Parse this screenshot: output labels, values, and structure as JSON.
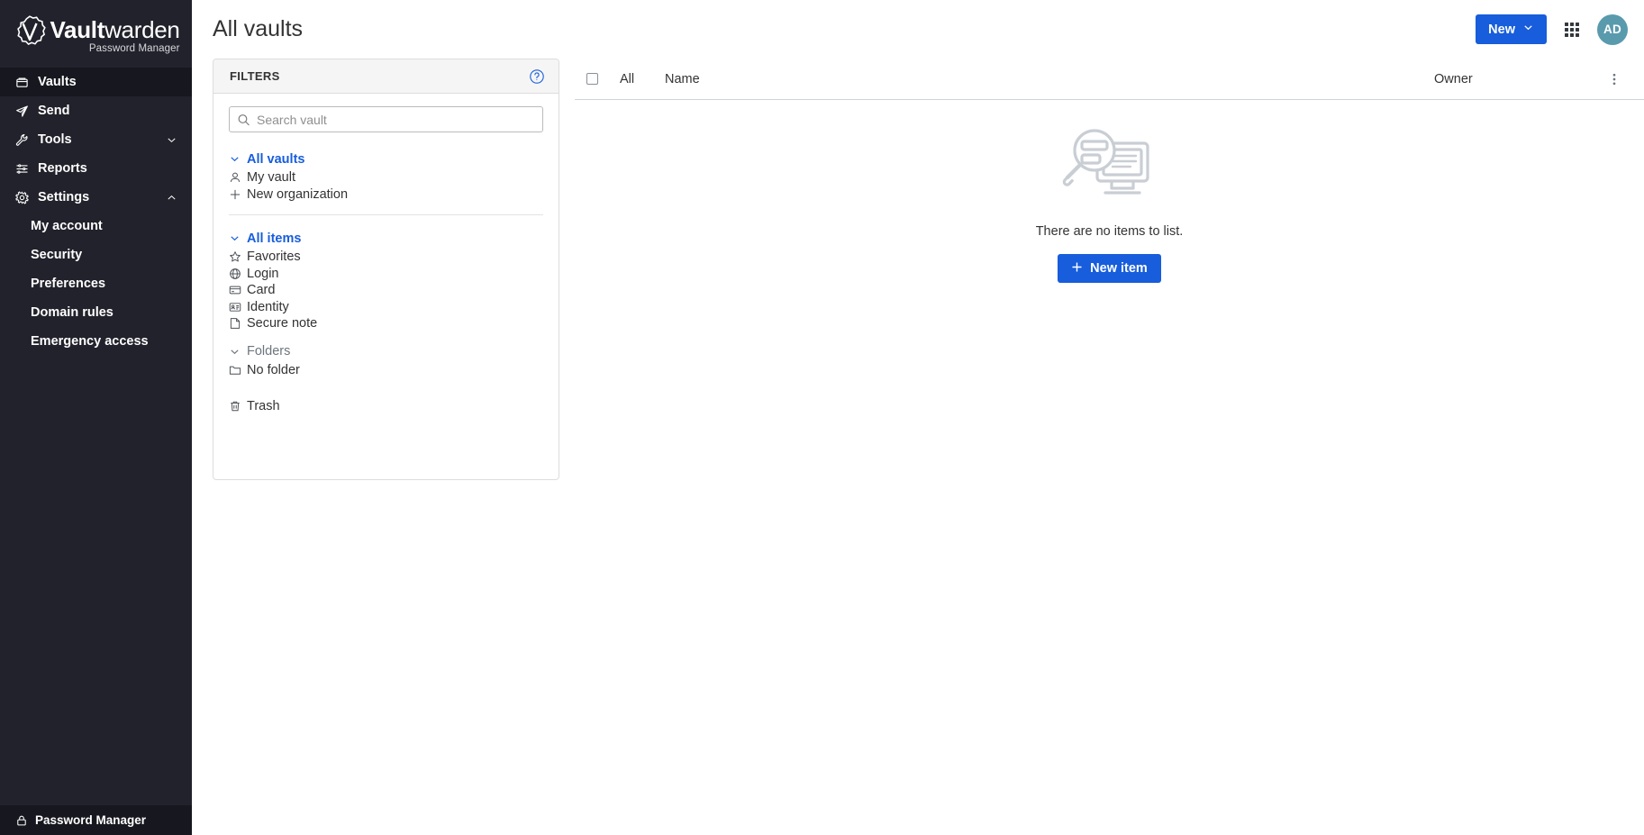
{
  "brand": {
    "name_bold": "ault",
    "name_light": "warden",
    "name_initial": "V",
    "subtitle": "Password Manager",
    "accent": "#175ddc",
    "sidebar_bg": "#21222b"
  },
  "sidebar": {
    "items": [
      {
        "label": "Vaults",
        "icon": "vault-icon",
        "active": true,
        "expandable": false
      },
      {
        "label": "Send",
        "icon": "send-icon",
        "active": false,
        "expandable": false
      },
      {
        "label": "Tools",
        "icon": "wrench-icon",
        "active": false,
        "expandable": true,
        "expanded": false
      },
      {
        "label": "Reports",
        "icon": "reports-icon",
        "active": false,
        "expandable": false
      },
      {
        "label": "Settings",
        "icon": "gear-icon",
        "active": false,
        "expandable": true,
        "expanded": true
      }
    ],
    "settings_children": [
      {
        "label": "My account"
      },
      {
        "label": "Security"
      },
      {
        "label": "Preferences"
      },
      {
        "label": "Domain rules"
      },
      {
        "label": "Emergency access"
      }
    ],
    "footer": {
      "label": "Password Manager",
      "icon": "lock-icon"
    }
  },
  "header": {
    "title": "All vaults",
    "new_button": "New",
    "new_button_icon": "chevron-down-icon",
    "apps_icon": "grid-apps-icon",
    "avatar_initials": "AD",
    "avatar_color": "#5a9aad"
  },
  "filters": {
    "title": "FILTERS",
    "help_icon": "help-circle-icon",
    "search": {
      "placeholder": "Search vault",
      "value": "",
      "icon": "search-icon"
    },
    "vaults_group": {
      "header": "All vaults",
      "items": [
        {
          "label": "My vault",
          "icon": "user-icon"
        },
        {
          "label": "New organization",
          "icon": "plus-icon"
        }
      ]
    },
    "items_group": {
      "header": "All items",
      "items": [
        {
          "label": "Favorites",
          "icon": "star-icon"
        },
        {
          "label": "Login",
          "icon": "globe-icon"
        },
        {
          "label": "Card",
          "icon": "credit-card-icon"
        },
        {
          "label": "Identity",
          "icon": "id-card-icon"
        },
        {
          "label": "Secure note",
          "icon": "note-icon"
        }
      ]
    },
    "folders_group": {
      "header": "Folders",
      "items": [
        {
          "label": "No folder",
          "icon": "folder-icon"
        }
      ]
    },
    "trash": {
      "label": "Trash",
      "icon": "trash-icon"
    }
  },
  "table": {
    "columns": {
      "select_all": "All",
      "name": "Name",
      "owner": "Owner"
    },
    "options_icon": "kebab-menu-icon",
    "rows": []
  },
  "empty_state": {
    "illustration": "magnifier-monitor-illustration",
    "message": "There are no items to list.",
    "action_label": "New item",
    "action_icon": "plus-icon"
  }
}
